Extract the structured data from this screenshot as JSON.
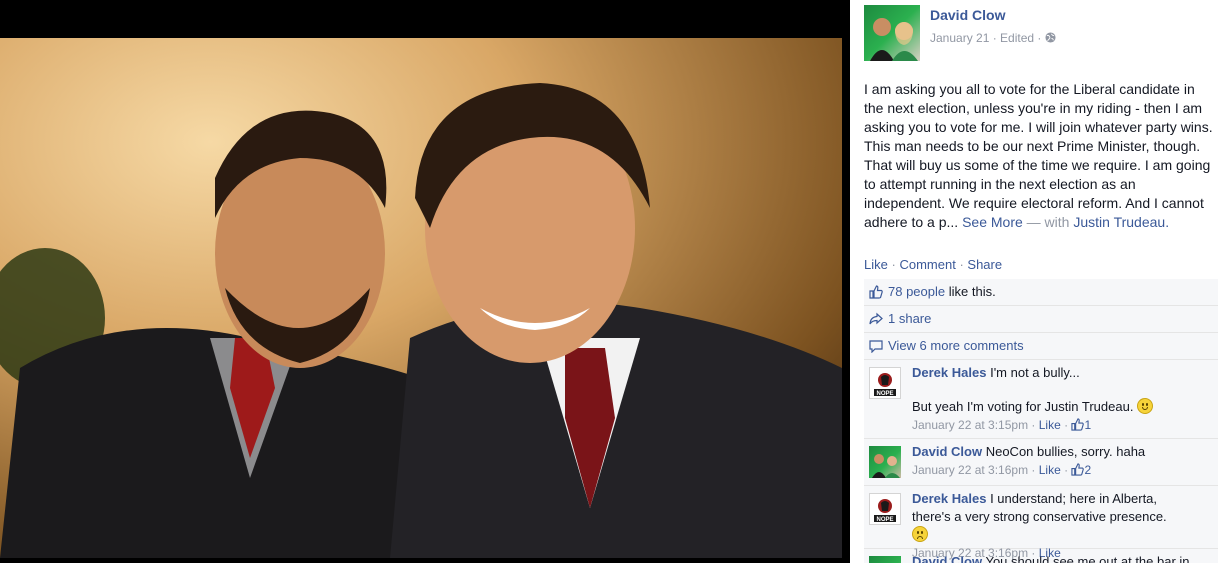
{
  "post": {
    "author": "David Clow",
    "date": "January 21",
    "edited": "Edited",
    "meta_sep": " · ",
    "text_main": "I am asking you all to vote for the Liberal candidate in the next election, unless you're in my riding - then I am asking you to vote for me. I will join whatever party wins. This man needs to be our next Prime Minister, though. That will buy us some of the time we require. I am going to attempt running in the next election as an independent. We require electoral reform. And I cannot adhere to a p...",
    "see_more": "See More",
    "with_prefix": "— with",
    "tagged": "Justin Trudeau.",
    "privacy_icon": "globe-icon"
  },
  "actions": {
    "like": "Like",
    "comment": "Comment",
    "share": "Share",
    "sep": "·"
  },
  "feedback": {
    "likes_link": "78 people",
    "likes_rest": "like this.",
    "shares": "1 share",
    "view_more": "View 6 more comments"
  },
  "comments": [
    {
      "author": "Derek Hales",
      "text": "I'm not a bully...",
      "text2": "But yeah I'm voting for Justin Trudeau.",
      "time": "January 22 at 3:15pm",
      "like": "Like",
      "likes": "1",
      "avatar_label": "NOPE"
    },
    {
      "author": "David Clow",
      "text": "NeoCon bullies, sorry. haha",
      "time": "January 22 at 3:16pm",
      "like": "Like",
      "likes": "2"
    },
    {
      "author": "Derek Hales",
      "text": "I understand; here in Alberta, there's a very strong conservative presence.",
      "time": "January 22 at 3:16pm",
      "like": "Like",
      "avatar_label": "NOPE"
    },
    {
      "author": "David Clow",
      "text": "You should see me out at the bar in"
    }
  ],
  "colors": {
    "link": "#3b5998",
    "muted": "#9197a3",
    "feedback_bg": "#f6f7f9"
  }
}
